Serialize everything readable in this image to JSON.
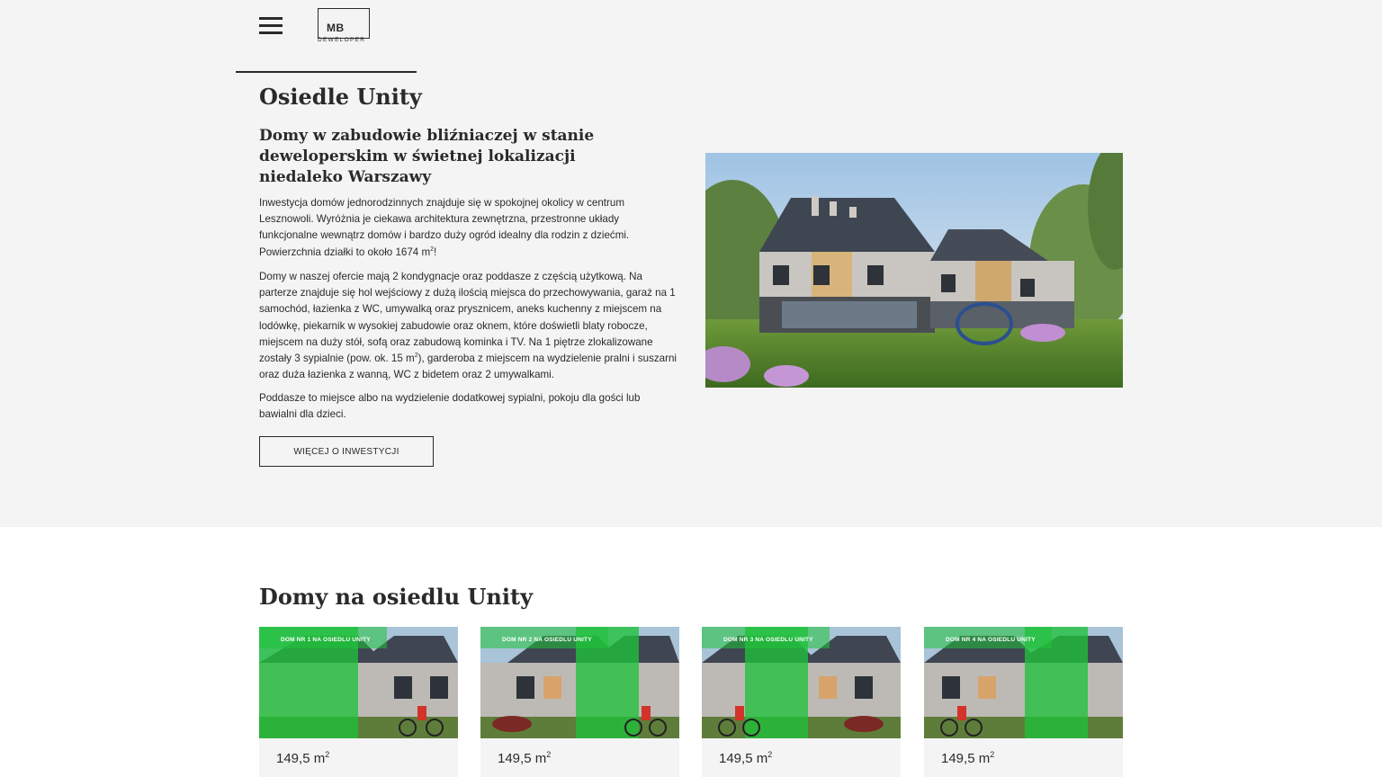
{
  "header": {
    "menu_icon": "hamburger-menu-icon",
    "logo": {
      "mark": "MB",
      "subtitle": "DEWELOPER"
    }
  },
  "hero": {
    "title": "Osiedle Unity",
    "subtitle": "Domy w zabudowie bliźniaczej w stanie deweloperskim w świetnej lokalizacji niedaleko Warszawy",
    "p1_text": "Inwestycja domów jednorodzinnych znajduje się w spokojnej okolicy w centrum Lesznowoli. Wyróżnia je ciekawa architektura zewnętrzna, przestronne układy funkcjonalne wewnątrz domów i bardzo duży ogród idealny dla rodzin z dziećmi. Powierzchnia działki to około 1674 m",
    "p1_sup": "2",
    "p1_end": "!",
    "p2_text_a": "Domy w naszej ofercie mają 2 kondygnacje oraz poddasze z częścią użytkową. Na parterze znajduje się hol wejściowy z dużą ilością miejsca do przechowywania, garaż na 1 samochód, łazienka z WC, umywalką oraz prysznicem, aneks kuchenny z miejscem na lodówkę, piekarnik w wysokiej zabudowie oraz oknem, które doświetli blaty robocze, miejscem na duży stół, sofą oraz zabudową kominka i TV. Na 1 piętrze zlokalizowane zostały 3 sypialnie (pow. ok. 15 m",
    "p2_sup": "2",
    "p2_text_b": "), garderoba z miejscem na wydzielenie pralni i suszarni oraz duża łazienka z wanną, WC z bidetem oraz 2 umywalkami.",
    "p3_text": "Poddasze to miejsce albo na wydzielenie dodatkowej sypialni, pokoju dla gości lub bawialni dla dzieci.",
    "button_label": "WIĘCEJ O INWESTYCJI"
  },
  "houses": {
    "title": "Domy na osiedlu Unity",
    "items": [
      {
        "tag": "DOM NR 1 NA OSIEDLU UNITY",
        "area": "149,5 m",
        "area_sup": "2"
      },
      {
        "tag": "DOM NR 2 NA OSIEDLU UNITY",
        "area": "149,5 m",
        "area_sup": "2"
      },
      {
        "tag": "DOM NR 3 NA OSIEDLU UNITY",
        "area": "149,5 m",
        "area_sup": "2"
      },
      {
        "tag": "DOM NR 4 NA OSIEDLU UNITY",
        "area": "149,5 m",
        "area_sup": "2"
      }
    ]
  },
  "colors": {
    "hero_bg": "#f4f4f4",
    "text": "#2a2a2a",
    "highlight_green": "#1fc23a"
  }
}
